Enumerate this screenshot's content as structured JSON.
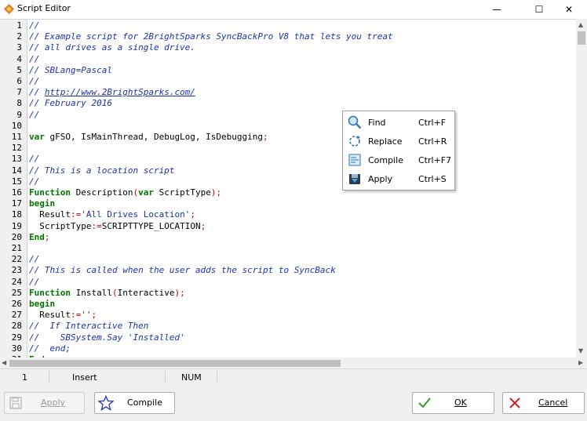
{
  "window": {
    "title": "Script Editor",
    "minimize": "—",
    "maximize": "☐",
    "close": "✕"
  },
  "editor": {
    "lines": [
      {
        "n": "1",
        "t": [
          {
            "c": "cm",
            "s": "//"
          }
        ]
      },
      {
        "n": "2",
        "t": [
          {
            "c": "cm",
            "s": "// Example script for 2BrightSparks SyncBackPro V8 that lets you treat"
          }
        ]
      },
      {
        "n": "3",
        "t": [
          {
            "c": "cm",
            "s": "// all drives as a single drive."
          }
        ]
      },
      {
        "n": "4",
        "t": [
          {
            "c": "cm",
            "s": "//"
          }
        ]
      },
      {
        "n": "5",
        "t": [
          {
            "c": "cm",
            "s": "// SBLang=Pascal"
          }
        ]
      },
      {
        "n": "6",
        "t": [
          {
            "c": "cm",
            "s": "//"
          }
        ]
      },
      {
        "n": "7",
        "t": [
          {
            "c": "cm",
            "s": "// "
          },
          {
            "c": "url",
            "s": "http://www.2BrightSparks.com/"
          }
        ]
      },
      {
        "n": "8",
        "t": [
          {
            "c": "cm",
            "s": "// February 2016"
          }
        ]
      },
      {
        "n": "9",
        "t": [
          {
            "c": "cm",
            "s": "//"
          }
        ]
      },
      {
        "n": "10",
        "t": []
      },
      {
        "n": "11",
        "t": [
          {
            "c": "kw",
            "s": "var"
          },
          {
            "c": "id",
            "s": " gFSO, IsMainThread, DebugLog, IsDebugging"
          },
          {
            "c": "sym",
            "s": ";"
          }
        ]
      },
      {
        "n": "12",
        "t": []
      },
      {
        "n": "13",
        "t": [
          {
            "c": "cm",
            "s": "//"
          }
        ]
      },
      {
        "n": "14",
        "t": [
          {
            "c": "cm",
            "s": "// This is a location script"
          }
        ]
      },
      {
        "n": "15",
        "t": [
          {
            "c": "cm",
            "s": "//"
          }
        ]
      },
      {
        "n": "16",
        "t": [
          {
            "c": "kw",
            "s": "Function"
          },
          {
            "c": "id",
            "s": " Description"
          },
          {
            "c": "sym",
            "s": "("
          },
          {
            "c": "kw",
            "s": "var"
          },
          {
            "c": "id",
            "s": " ScriptType"
          },
          {
            "c": "sym",
            "s": ");"
          }
        ]
      },
      {
        "n": "17",
        "t": [
          {
            "c": "kw",
            "s": "begin"
          }
        ]
      },
      {
        "n": "18",
        "t": [
          {
            "c": "id",
            "s": "  Result"
          },
          {
            "c": "sym",
            "s": ":="
          },
          {
            "c": "str",
            "s": "'All Drives Location'"
          },
          {
            "c": "sym",
            "s": ";"
          }
        ]
      },
      {
        "n": "19",
        "t": [
          {
            "c": "id",
            "s": "  ScriptType"
          },
          {
            "c": "sym",
            "s": ":="
          },
          {
            "c": "id",
            "s": "SCRIPTTYPE_LOCATION"
          },
          {
            "c": "sym",
            "s": ";"
          }
        ]
      },
      {
        "n": "20",
        "t": [
          {
            "c": "kw",
            "s": "End"
          },
          {
            "c": "sym",
            "s": ";"
          }
        ]
      },
      {
        "n": "21",
        "t": []
      },
      {
        "n": "22",
        "t": [
          {
            "c": "cm",
            "s": "//"
          }
        ]
      },
      {
        "n": "23",
        "t": [
          {
            "c": "cm",
            "s": "// This is called when the user adds the script to SyncBack"
          }
        ]
      },
      {
        "n": "24",
        "t": [
          {
            "c": "cm",
            "s": "//"
          }
        ]
      },
      {
        "n": "25",
        "t": [
          {
            "c": "kw",
            "s": "Function"
          },
          {
            "c": "id",
            "s": " Install"
          },
          {
            "c": "sym",
            "s": "("
          },
          {
            "c": "id",
            "s": "Interactive"
          },
          {
            "c": "sym",
            "s": ");"
          }
        ]
      },
      {
        "n": "26",
        "t": [
          {
            "c": "kw",
            "s": "begin"
          }
        ]
      },
      {
        "n": "27",
        "t": [
          {
            "c": "id",
            "s": "  Result"
          },
          {
            "c": "sym",
            "s": ":="
          },
          {
            "c": "str",
            "s": "''"
          },
          {
            "c": "sym",
            "s": ";"
          }
        ]
      },
      {
        "n": "28",
        "t": [
          {
            "c": "cm",
            "s": "//  If Interactive Then"
          }
        ]
      },
      {
        "n": "29",
        "t": [
          {
            "c": "cm",
            "s": "//    SBSystem.Say 'Installed'"
          }
        ]
      },
      {
        "n": "30",
        "t": [
          {
            "c": "cm",
            "s": "//  end;"
          }
        ]
      },
      {
        "n": "31",
        "t": [
          {
            "c": "kw",
            "s": "End"
          },
          {
            "c": "sym",
            "s": ";"
          }
        ]
      }
    ]
  },
  "status": {
    "line": "1",
    "mode": "Insert",
    "num": "NUM"
  },
  "buttons": {
    "apply": "Apply",
    "compile": "Compile",
    "ok": "OK",
    "cancel": "Cancel"
  },
  "context_menu": [
    {
      "label": "Find",
      "shortcut": "Ctrl+F",
      "icon": "magnifier-icon"
    },
    {
      "label": "Replace",
      "shortcut": "Ctrl+R",
      "icon": "replace-icon"
    },
    {
      "label": "Compile",
      "shortcut": "Ctrl+F7",
      "icon": "compile-icon"
    },
    {
      "label": "Apply",
      "shortcut": "Ctrl+S",
      "icon": "apply-icon"
    }
  ],
  "colors": {
    "comment": "#1c2fb0",
    "keyword": "#007400",
    "symbol": "#cc0000",
    "ok_check": "#2e9e2e",
    "cancel_x": "#d42020"
  }
}
